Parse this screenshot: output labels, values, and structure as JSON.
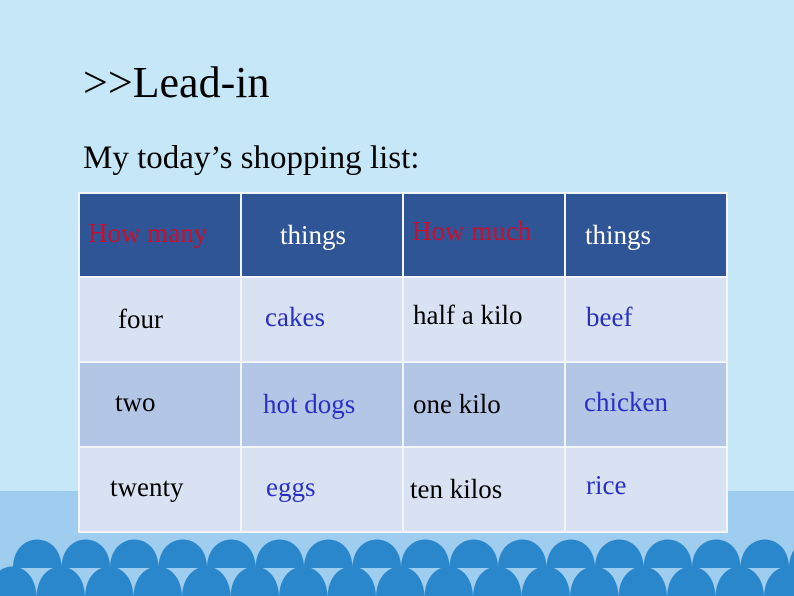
{
  "slide": {
    "title": ">>Lead-in",
    "subtitle": "My today’s shopping list:"
  },
  "table": {
    "headers": [
      "How many",
      "things",
      "How much",
      "things"
    ],
    "rows": [
      [
        "four",
        "cakes",
        "half a kilo",
        "beef"
      ],
      [
        "two",
        "hot dogs",
        "one kilo",
        "chicken"
      ],
      [
        "twenty",
        "eggs",
        "ten kilos",
        "rice"
      ]
    ]
  },
  "colors": {
    "background_light": "#c6e7f8",
    "background_band": "#9fcdef",
    "header_fill": "#2f5597",
    "header_question_text": "#c8102e",
    "header_things_text": "#ffffff",
    "row_light": "#d9e2f2",
    "row_dark": "#b3c6e6",
    "item_text": "#2a2fc4",
    "scallop": "#2b87cc"
  }
}
